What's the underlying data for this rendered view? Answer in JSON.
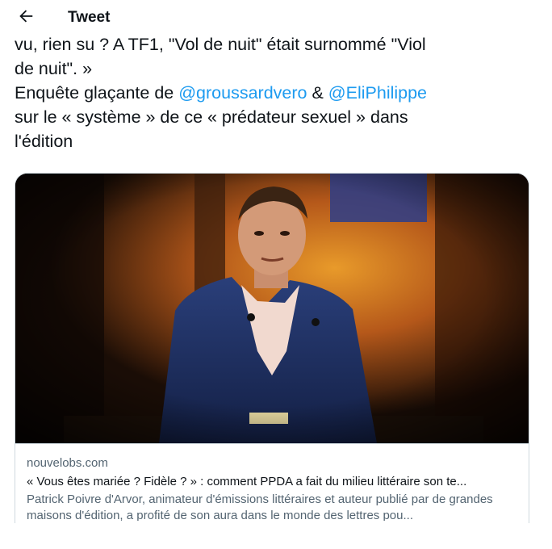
{
  "header": {
    "title": "Tweet",
    "back_icon": "arrow-left-icon"
  },
  "tweet": {
    "line1": "vu, rien su ? A TF1, \"Vol de nuit\" était surnommé \"Viol",
    "line2": "de nuit\". »",
    "line3_prefix": "Enquête glaçante de ",
    "mention1": "@groussardvero",
    "line3_mid": " & ",
    "mention2": "@EliPhilippe",
    "line4": "sur le « système » de ce « prédateur sexuel » dans",
    "line5": "l'édition"
  },
  "card": {
    "domain": "nouvelobs.com",
    "title": "« Vous êtes mariée ? Fidèle ? » : comment PPDA a fait du milieu littéraire son te...",
    "description": "Patrick Poivre d'Arvor, animateur d'émissions littéraires et auteur publié par de grandes maisons d'édition, a profité de son aura dans le monde des lettres pou..."
  },
  "colors": {
    "text": "#0f1419",
    "secondary": "#536471",
    "link": "#1d9bf0",
    "border": "#cfd9de"
  }
}
